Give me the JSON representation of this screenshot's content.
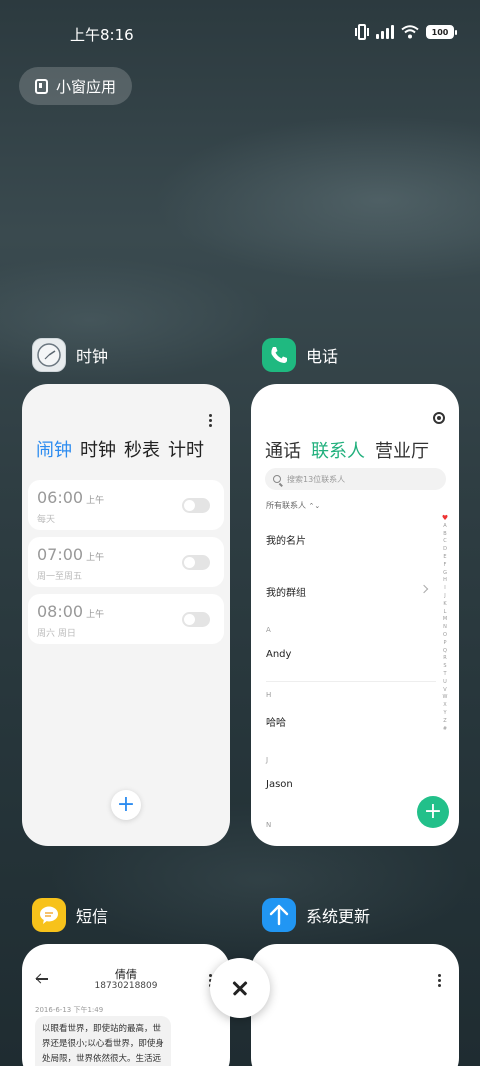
{
  "status_bar": {
    "time": "上午8:16",
    "battery": "100",
    "icons": [
      "vibrate-icon",
      "signal-icon",
      "wifi-icon",
      "battery-icon"
    ]
  },
  "small_window_button": {
    "label": "小窗应用",
    "icon": "small-window-icon"
  },
  "apps": {
    "clock": {
      "name": "时钟",
      "icon": "clock-icon",
      "tabs": [
        "闹钟",
        "时钟",
        "秒表",
        "计时"
      ],
      "active_tab": "闹钟",
      "alarms": [
        {
          "time": "06:00",
          "ampm": "上午",
          "repeat": "每天",
          "enabled": false
        },
        {
          "time": "07:00",
          "ampm": "上午",
          "repeat": "周一至周五",
          "enabled": false
        },
        {
          "time": "08:00",
          "ampm": "上午",
          "repeat": "周六 周日",
          "enabled": false
        }
      ],
      "add_label": "+"
    },
    "phone": {
      "name": "电话",
      "icon": "phone-icon",
      "tabs": [
        "通话",
        "联系人",
        "营业厅"
      ],
      "active_tab": "联系人",
      "search_placeholder": "搜索13位联系人",
      "all_contacts_label": "所有联系人",
      "my_card": "我的名片",
      "my_groups": "我的群组",
      "sections": [
        {
          "letter": "A",
          "contact": "Andy"
        },
        {
          "letter": "H",
          "contact": "哈哈"
        },
        {
          "letter": "J",
          "contact": "Jason"
        },
        {
          "letter": "N",
          "contact": ""
        }
      ],
      "alpha_index": [
        "♥",
        "A",
        "B",
        "C",
        "D",
        "E",
        "F",
        "G",
        "H",
        "I",
        "J",
        "K",
        "L",
        "M",
        "N",
        "O",
        "P",
        "Q",
        "R",
        "S",
        "T",
        "U",
        "V",
        "W",
        "X",
        "Y",
        "Z",
        "#"
      ],
      "add_label": "+"
    },
    "messages": {
      "name": "短信",
      "icon": "message-icon",
      "contact_name": "倩倩",
      "contact_number": "18730218809",
      "date": "2016-6-13 下午1:49",
      "message_text": "以眼看世界，即使站的最高，世界还是很小;以心看世界，即使身处局限，世界依然很大。生活远"
    },
    "update": {
      "name": "系统更新",
      "icon": "update-arrow-icon"
    }
  },
  "colors": {
    "clock_accent": "#2d8cf0",
    "phone_accent": "#22b07d",
    "phone_icon_bg": "#1fb980",
    "sms_icon_bg": "#f7c21b",
    "update_icon_bg": "#2196f3"
  }
}
